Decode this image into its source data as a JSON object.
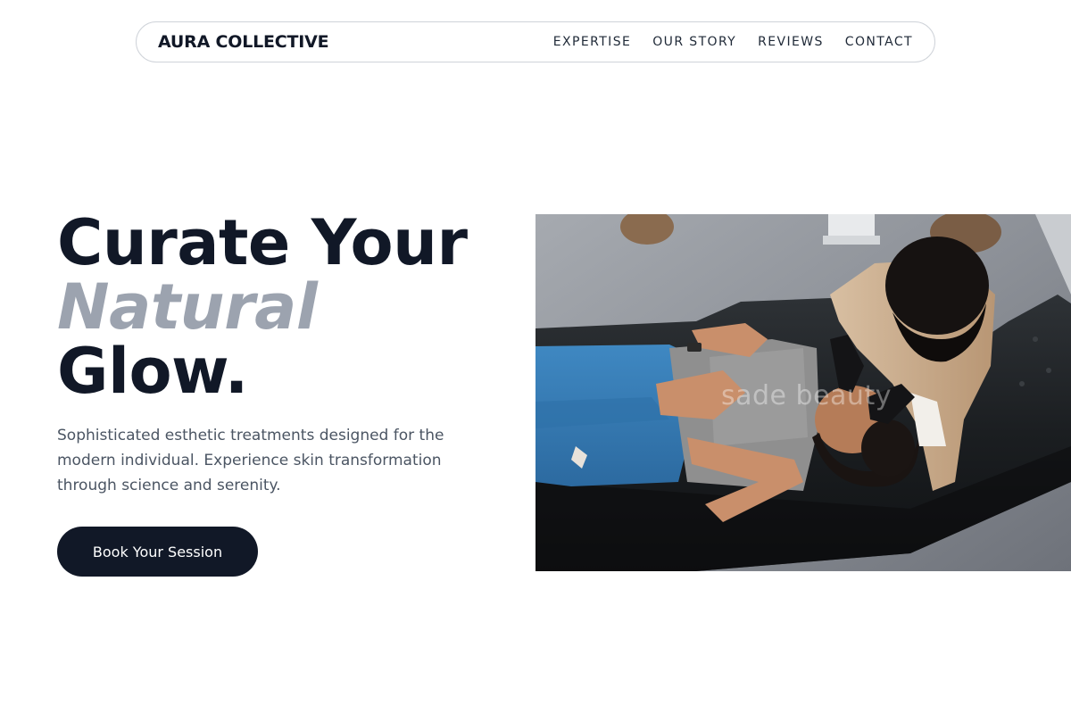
{
  "nav": {
    "brand": "AURA COLLECTIVE",
    "links": [
      "EXPERTISE",
      "OUR STORY",
      "REVIEWS",
      "CONTACT"
    ]
  },
  "hero": {
    "title_line1": "Curate Your",
    "title_accent": "Natural",
    "title_line3": "Glow.",
    "description": "Sophisticated esthetic treatments designed for the modern individual. Experience skin transformation through science and serenity.",
    "cta_label": "Book Your Session",
    "image_watermark": "sade beauty"
  },
  "colors": {
    "primary": "#111827",
    "accent_text": "#9ca3af",
    "body_text": "#4b5563",
    "background": "#ffffff"
  }
}
